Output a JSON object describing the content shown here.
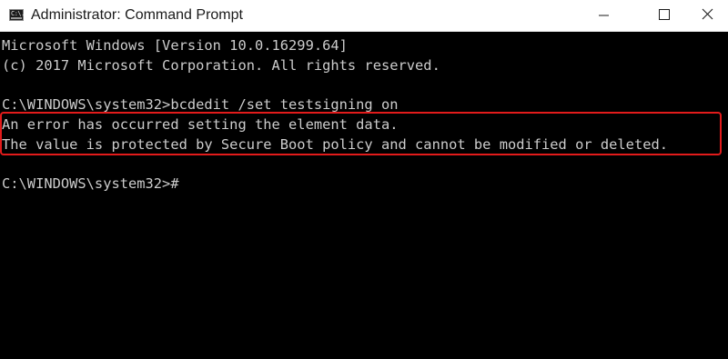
{
  "window": {
    "title": "Administrator: Command Prompt",
    "icon": "cmd-app-icon",
    "icon_text": "C:\\.",
    "controls": [
      "minimize-icon",
      "maximize-icon",
      "close-icon"
    ]
  },
  "console": {
    "lines": [
      "Microsoft Windows [Version 10.0.16299.64]",
      "(c) 2017 Microsoft Corporation. All rights reserved.",
      "C:\\WINDOWS\\system32>bcdedit /set testsigning on",
      "An error has occurred setting the element data.",
      "The value is protected by Secure Boot policy and cannot be modified or deleted.",
      "C:\\WINDOWS\\system32>#"
    ]
  },
  "colors": {
    "console_background": "#000000",
    "console_text": "#cccccc",
    "highlight_border": "#e21b1b",
    "titlebar_background": "#ffffff"
  }
}
